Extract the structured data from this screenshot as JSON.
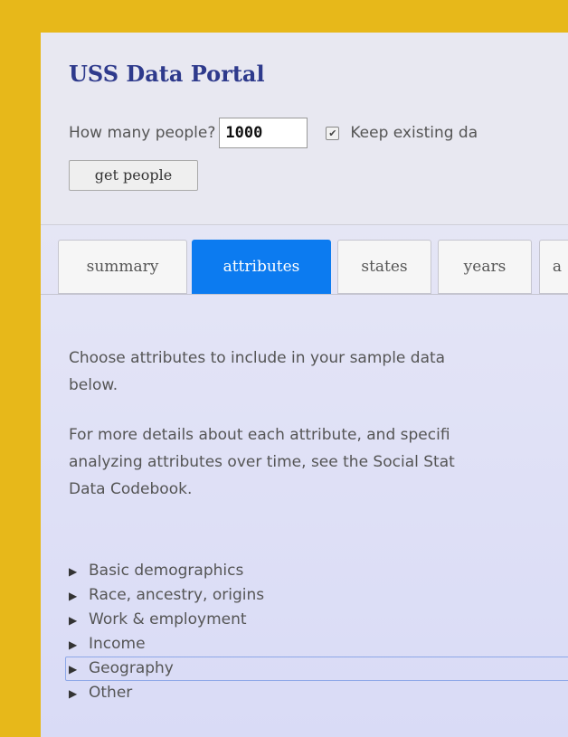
{
  "app": {
    "title": "USS Data Portal",
    "how_many_label": "How many people?",
    "how_many_value": "1000",
    "keep_existing_label": "Keep existing da",
    "keep_existing_checked": true,
    "get_people_label": "get people"
  },
  "tabs": [
    {
      "label": "summary",
      "active": false
    },
    {
      "label": "attributes",
      "active": true
    },
    {
      "label": "states",
      "active": false
    },
    {
      "label": "years",
      "active": false
    },
    {
      "label": "a",
      "active": false
    }
  ],
  "content": {
    "intro_lines": [
      "Choose attributes to include in your sample data",
      "below."
    ],
    "details_lines": [
      "For more details about each attribute, and specifi",
      "analyzing attributes over time, see the Social Stat",
      "Data Codebook."
    ]
  },
  "categories": [
    {
      "label": "Basic demographics",
      "focused": false
    },
    {
      "label": "Race, ancestry, origins",
      "focused": false
    },
    {
      "label": "Work & employment",
      "focused": false
    },
    {
      "label": "Income",
      "focused": false
    },
    {
      "label": "Geography",
      "focused": true
    },
    {
      "label": "Other",
      "focused": false
    }
  ],
  "colors": {
    "background": "#E7B81A",
    "title": "#2E3A8C",
    "active_tab": "#0C7BF0",
    "focus_outline": "#8EA8E8"
  }
}
